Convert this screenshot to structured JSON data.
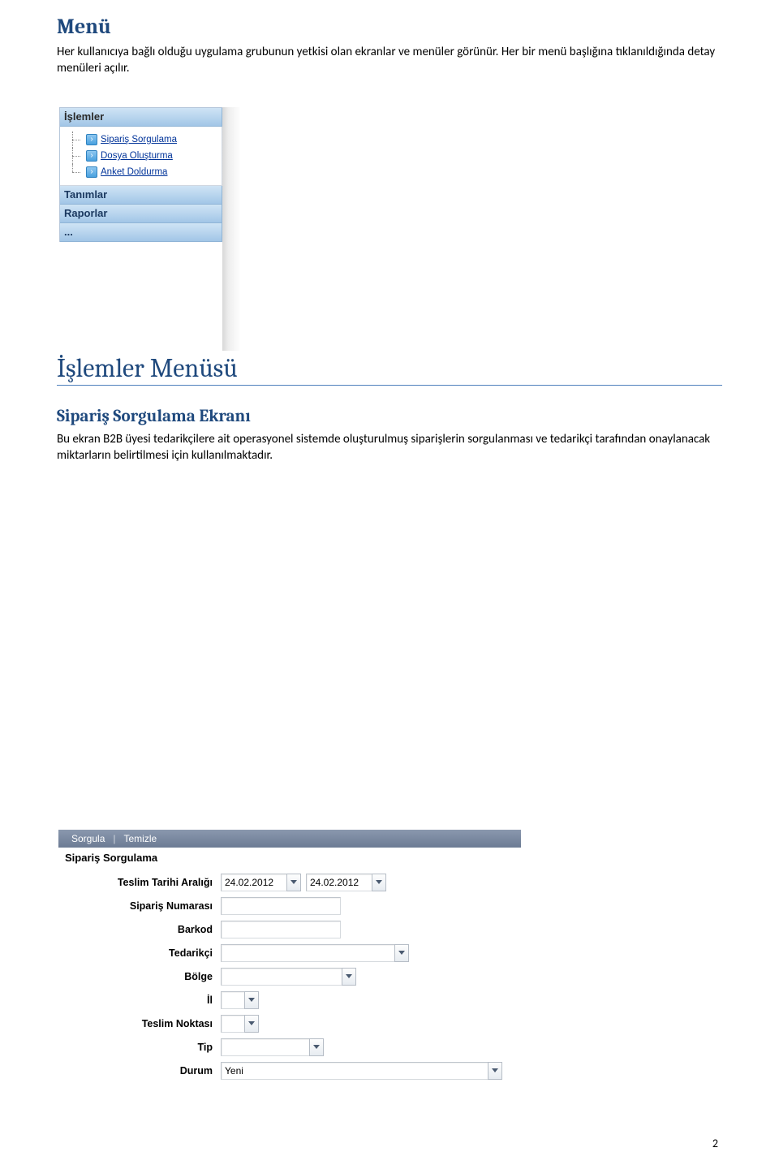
{
  "headings": {
    "h1": "Menü",
    "h2": "İşlemler Menüsü",
    "h3": "Sipariş Sorgulama Ekranı"
  },
  "paragraphs": {
    "p1": "Her kullanıcıya bağlı olduğu uygulama grubunun yetkisi olan ekranlar ve menüler görünür. Her bir menü başlığına tıklanıldığında detay menüleri açılır.",
    "p2": "Bu ekran B2B üyesi tedarikçilere ait operasyonel sistemde oluşturulmuş siparişlerin sorgulanması ve tedarikçi tarafından onaylanacak miktarların belirtilmesi için kullanılmaktadır."
  },
  "screenshot1": {
    "sections": {
      "islemler": "İşlemler",
      "tanimlar": "Tanımlar",
      "raporlar": "Raporlar",
      "more": "..."
    },
    "tree": [
      "Sipariş Sorgulama",
      "Dosya Oluşturma",
      "Anket Doldurma"
    ]
  },
  "screenshot2": {
    "toolbar": {
      "query": "Sorgula",
      "clear": "Temizle"
    },
    "title": "Sipariş Sorgulama",
    "labels": {
      "dateRange": "Teslim Tarihi Aralığı",
      "orderNo": "Sipariş Numarası",
      "barcode": "Barkod",
      "supplier": "Tedarikçi",
      "region": "Bölge",
      "province": "İl",
      "deliveryPoint": "Teslim Noktası",
      "type": "Tip",
      "status": "Durum"
    },
    "values": {
      "date1": "24.02.2012",
      "date2": "24.02.2012",
      "orderNo": "",
      "barcode": "",
      "supplier": "",
      "region": "",
      "province": "",
      "deliveryPoint": "",
      "type": "",
      "status": "Yeni"
    }
  },
  "pageNumber": "2"
}
